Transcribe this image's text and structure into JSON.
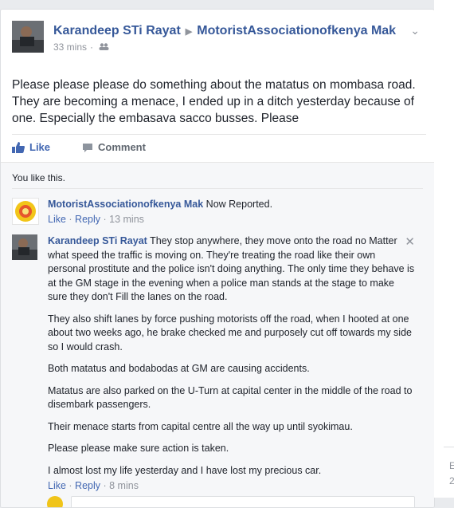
{
  "post": {
    "author": "Karandeep STi Rayat",
    "target_group": "MotoristAssociationofkenya Mak",
    "time": "33 mins",
    "privacy_icon": "friends-icon",
    "text": "Please please please do something about the matatus on mombasa road. They are becoming a menace, I ended up in a ditch yesterday because of one. Especially the embasava sacco busses. Please",
    "actions": {
      "like": "Like",
      "comment": "Comment"
    }
  },
  "feedback": {
    "likes_summary": "You like this.",
    "comments": [
      {
        "author": "MotoristAssociationofkenya Mak",
        "text": "Now Reported.",
        "like": "Like",
        "reply": "Reply",
        "time": "13 mins"
      },
      {
        "author": "Karandeep STi Rayat",
        "paragraphs": [
          "They stop anywhere, they move onto the road no Matter what speed the traffic is moving on. They're treating the road like their own personal prostitute and the police isn't doing anything. The only time they behave is at the GM stage in the evening when a police man stands at the stage to make sure they don't Fill the lanes on the road.",
          "They also shift lanes by force pushing motorists off the road, when I hooted at one about two weeks ago, he brake checked me and purposely cut off towards my side so I would crash.",
          "Both matatus and bodabodas at GM are causing accidents.",
          "Matatus are also parked on the U-Turn at capital center in the middle of the road to disembark passengers.",
          "Their menace starts from capital centre all the way up until syokimau.",
          "Please please make sure action is taken.",
          "I almost lost my life yesterday and I have lost my precious car."
        ],
        "like": "Like",
        "reply": "Reply",
        "time": "8 mins"
      }
    ]
  },
  "sidebar_fragment": {
    "letters": [
      "E",
      "2"
    ]
  },
  "colors": {
    "link": "#365899",
    "action_blue": "#4267b2",
    "muted": "#90949c",
    "feedback_bg": "#f6f7f9"
  }
}
